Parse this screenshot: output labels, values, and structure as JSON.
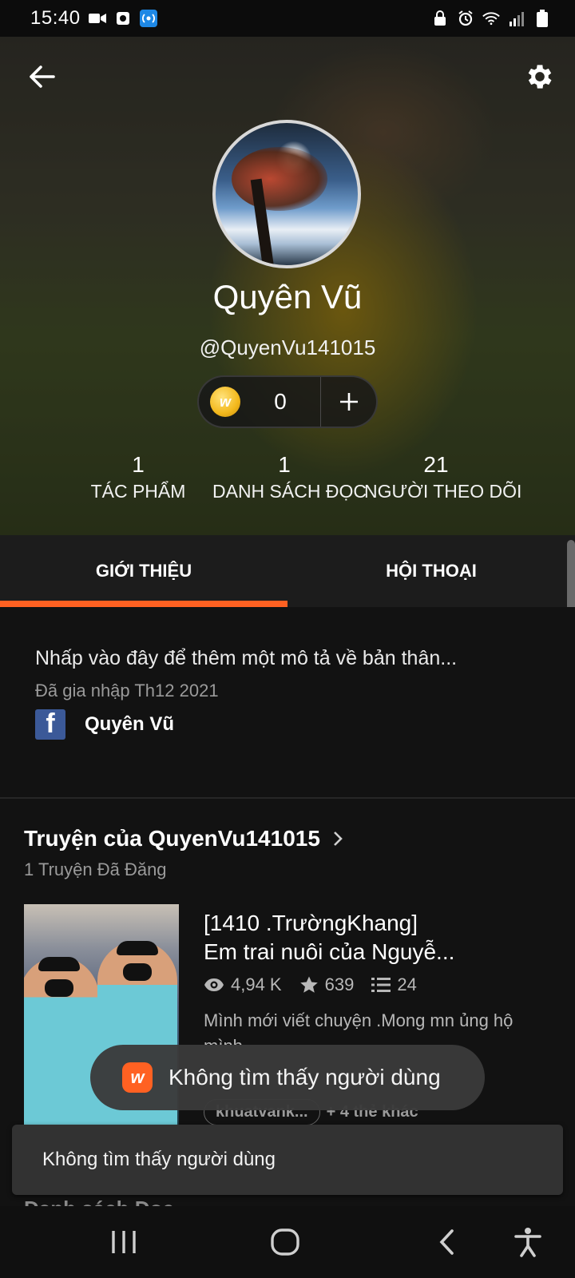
{
  "status_bar": {
    "time": "15:40"
  },
  "profile": {
    "display_name": "Quyên  Vũ",
    "handle": "@QuyenVu141015",
    "coins": "0",
    "coin_add": "+"
  },
  "stats": [
    {
      "value": "1",
      "label": "TÁC PHẨM"
    },
    {
      "value": "1",
      "label": "DANH SÁCH ĐỌC"
    },
    {
      "value": "21",
      "label": "NGƯỜI THEO DÕI"
    }
  ],
  "tabs": [
    {
      "label": "GIỚI THIỆU",
      "active": true
    },
    {
      "label": "HỘI THOẠI",
      "active": false
    }
  ],
  "about": {
    "description_placeholder": "Nhấp vào đây để thêm một mô tả về bản thân...",
    "joined": "Đã gia nhập Th12 2021",
    "facebook_name": "Quyên  Vũ"
  },
  "stories": {
    "title": "Truyện của QuyenVu141015",
    "subtitle": "1 Truyện Đã Đăng",
    "items": [
      {
        "title_line1": "[1410 .TrườngKhang]",
        "title_line2": "Em trai nuôi của Nguyễ...",
        "reads": "4,94 K",
        "votes": "639",
        "parts": "24",
        "description": "Mình mới viết chuyện .Mong mn ủng hộ mình",
        "tag": "khuatvank...",
        "more_tags": "+ 4 thẻ khác"
      }
    ]
  },
  "next_section_label": "Danh sách Đọc",
  "toast": {
    "text": "Không tìm thấy người dùng",
    "logo": "w"
  },
  "snackbar": {
    "text": "Không tìm thấy người dùng"
  },
  "colors": {
    "accent": "#ff6122",
    "background": "#121212",
    "facebook": "#3b5998"
  },
  "icons": [
    "back-arrow-icon",
    "settings-gear-icon",
    "coin-icon",
    "plus-icon",
    "facebook-icon",
    "chevron-right-icon",
    "eye-icon",
    "star-icon",
    "list-icon",
    "wattpad-logo-icon",
    "recents-icon",
    "home-icon",
    "nav-back-icon",
    "accessibility-icon"
  ]
}
